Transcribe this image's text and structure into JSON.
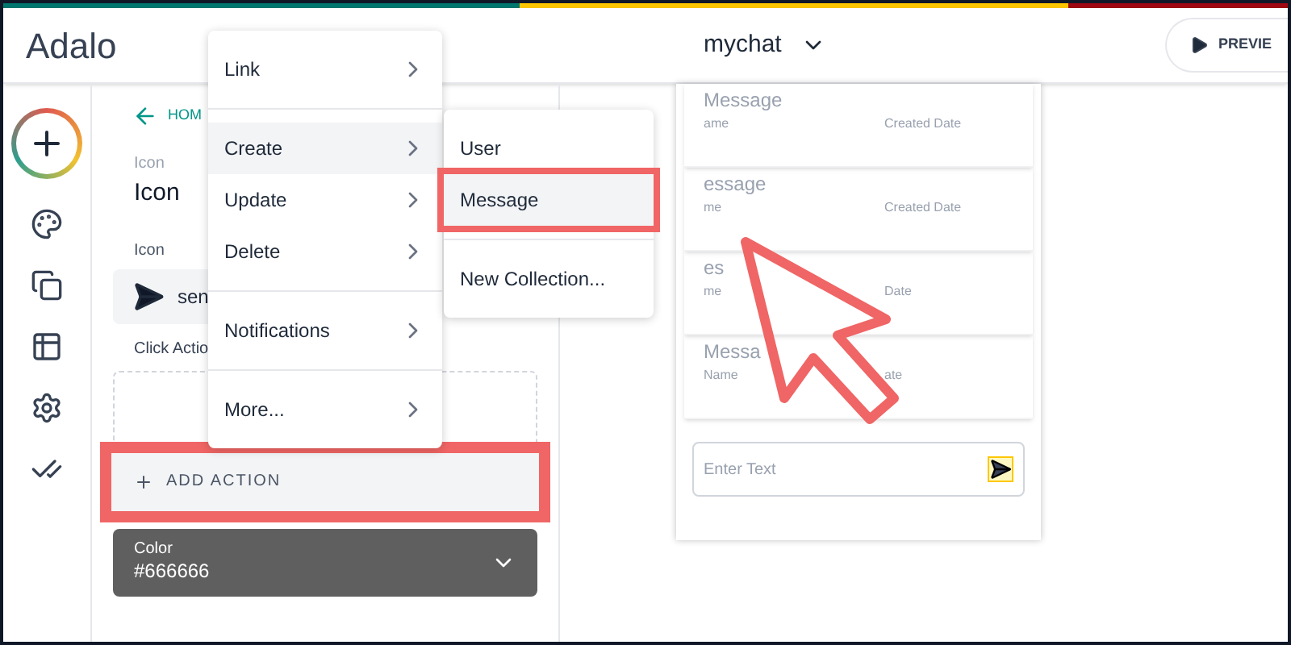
{
  "header": {
    "logo": "Adalo",
    "app_name": "mychat",
    "preview_button": "PREVIE"
  },
  "rail": [
    {
      "kind": "add"
    },
    {
      "kind": "palette"
    },
    {
      "kind": "screens"
    },
    {
      "kind": "database"
    },
    {
      "kind": "settings"
    },
    {
      "kind": "publish"
    }
  ],
  "panel": {
    "back_link": "HOM",
    "component_type": "Icon",
    "component_name": "Icon",
    "icon_label": "Icon",
    "icon_value": "sen",
    "click_actions_label": "Click Actio",
    "add_action": "ADD ACTION",
    "color_label": "Color",
    "color_value": "#666666"
  },
  "menu": [
    {
      "label": "Link",
      "selected": false,
      "divider_before": false
    },
    {
      "label": "Create",
      "selected": true,
      "divider_before": true
    },
    {
      "label": "Update",
      "selected": false,
      "divider_before": false
    },
    {
      "label": "Delete",
      "selected": false,
      "divider_before": false
    },
    {
      "label": "Notifications",
      "selected": false,
      "divider_before": true
    },
    {
      "label": "More...",
      "selected": false,
      "divider_before": true
    }
  ],
  "submenu": [
    {
      "label": "User",
      "selected": false,
      "divider_before": false
    },
    {
      "label": "Message",
      "selected": true,
      "divider_before": false
    },
    {
      "label": "New Collection...",
      "selected": false,
      "divider_before": true
    }
  ],
  "cards": [
    {
      "title": "Message",
      "name": "ame",
      "date": "Created Date"
    },
    {
      "title": "essage",
      "name": "me",
      "date": "Created Date"
    },
    {
      "title": "es",
      "name": "me",
      "date": "Date"
    },
    {
      "title": "Messa",
      "name": "Name",
      "date": "ate"
    }
  ],
  "chat_input": {
    "placeholder": "Enter Text"
  }
}
